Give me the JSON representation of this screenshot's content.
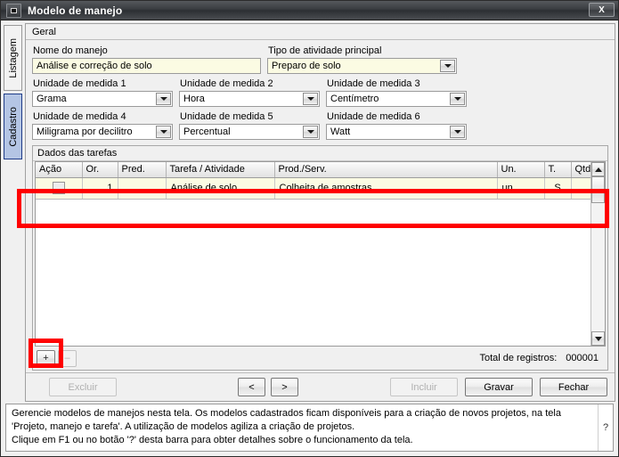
{
  "window": {
    "title": "Modelo de manejo",
    "sysmenu_icon": "minimize-box-icon",
    "close_label": "X"
  },
  "side_tabs": [
    {
      "label": "Listagem",
      "selected": false
    },
    {
      "label": "Cadastro",
      "selected": true
    }
  ],
  "panel": {
    "tab_label": "Geral"
  },
  "form": {
    "nome_manejo": {
      "label": "Nome do manejo",
      "value": "Análise e correção de solo"
    },
    "tipo_atividade": {
      "label": "Tipo de atividade principal",
      "value": "Preparo de solo"
    },
    "unidade1": {
      "label": "Unidade de medida 1",
      "value": "Grama"
    },
    "unidade2": {
      "label": "Unidade de medida 2",
      "value": "Hora"
    },
    "unidade3": {
      "label": "Unidade de medida 3",
      "value": "Centímetro"
    },
    "unidade4": {
      "label": "Unidade de medida 4",
      "value": "Miligrama por decilitro"
    },
    "unidade5": {
      "label": "Unidade de medida 5",
      "value": "Percentual"
    },
    "unidade6": {
      "label": "Unidade de medida 6",
      "value": "Watt"
    }
  },
  "grid": {
    "title": "Dados das tarefas",
    "columns": [
      "Ação",
      "Or.",
      "Pred.",
      "Tarefa / Atividade",
      "Prod./Serv.",
      "Un.",
      "T.",
      "Qtd./ha P."
    ],
    "rows": [
      {
        "acao": "",
        "or": "1",
        "pred": "",
        "tarefa": "Análise de solo",
        "prod_serv": "Colheita de amostras",
        "un": "un",
        "t": "S",
        "qtd_ha_p": ""
      }
    ],
    "toolbar": {
      "add_label": "+",
      "remove_label": "–"
    },
    "total_label": "Total de registros:",
    "total_value": "000001"
  },
  "actions": {
    "excluir": "Excluir",
    "prev": "<",
    "next": ">",
    "incluir": "Incluir",
    "gravar": "Gravar",
    "fechar": "Fechar"
  },
  "status": {
    "line1": "Gerencie modelos de manejos nesta tela. Os modelos cadastrados ficam disponíveis para a criação de novos projetos, na tela",
    "line2": "'Projeto, manejo e tarefa'. A utilização de modelos agiliza a criação de projetos.",
    "line3": "Clique em F1 ou no botão '?' desta barra para obter detalhes sobre o funcionamento da tela.",
    "help_label": "?"
  },
  "annotations": {
    "highlight_color": "#ff0000",
    "boxes": [
      "grid-first-row",
      "grid-add-button"
    ]
  }
}
